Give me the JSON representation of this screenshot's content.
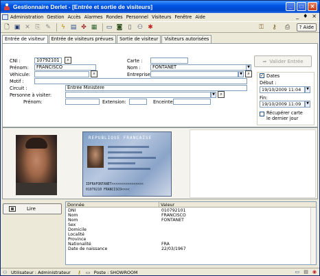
{
  "window": {
    "title": "Gestionnaire Derlet - [Entrée et sortie de visiteurs]",
    "controls": {
      "minimize": "_",
      "maximize": "□",
      "close": "✕"
    }
  },
  "menubar": {
    "items": [
      "Administration",
      "Gestion",
      "Accès",
      "Alarmes",
      "Rondes",
      "Personnel",
      "Visiteurs",
      "Fenêtre",
      "Aide"
    ],
    "right": [
      "_",
      "♦",
      "×"
    ]
  },
  "toolbar": {
    "aide_label": "Aide"
  },
  "tabs": [
    {
      "label": "Entrée de visiteur"
    },
    {
      "label": "Entrée de visiteurs prévues"
    },
    {
      "label": "Sortie de visiteur"
    },
    {
      "label": "Visiteurs autorisées"
    }
  ],
  "form": {
    "cni_label": "CNI :",
    "cni_value": "10792101",
    "carte_label": "Carte :",
    "prenom_label": "Prénom:",
    "prenom_value": "FRANCISCO",
    "nom_label": "Nom :",
    "nom_value": "FONTANET",
    "vehicule_label": "Véhicule:",
    "entreprise_label": "Entreprise:",
    "motif_label": "Motif :",
    "circuit_label": "Circuit :",
    "circuit_value": "Entrée Ministère",
    "personne_label": "Personne à visiter:",
    "prenoms_label": "Prénom:",
    "extension_label": "Extension:",
    "enceinte_label": "Enceinte"
  },
  "actions": {
    "valider_label": "Valider Entrée"
  },
  "dates": {
    "dates_label": "Dates",
    "debut_label": "Début :",
    "debut_value": "19/10/2009 11:04",
    "fin_label": "Fin:",
    "fin_value": "19/10/2009 11:09",
    "recuperer_label_1": "Récupérer carte",
    "recuperer_label_2": "le dernier jour"
  },
  "idcard": {
    "header": "REPUBLIQUE FRANCAISE",
    "mrz_1": "IDFRAFONTANET<<<<<<<<<<<<<<<<",
    "mrz_2": "01079210   FRANCISCO<<<<"
  },
  "reader": {
    "lire_label": "Lire"
  },
  "table": {
    "headers": [
      "Donnée",
      "Valeur"
    ],
    "rows": [
      [
        "DNI",
        "010792101"
      ],
      [
        "Nom",
        "FRANCISCO"
      ],
      [
        "Nom",
        "FONTANET"
      ],
      [
        "Sex",
        ""
      ],
      [
        "Domicile",
        ""
      ],
      [
        "Localité",
        ""
      ],
      [
        "Province",
        ""
      ],
      [
        "Nationalité",
        "FRA"
      ],
      [
        "Date de naissance",
        "22/03/1967"
      ]
    ]
  },
  "statusbar": {
    "user": "Utilisateur : Administrateur",
    "poste": "Poste : SHOWROOM"
  }
}
